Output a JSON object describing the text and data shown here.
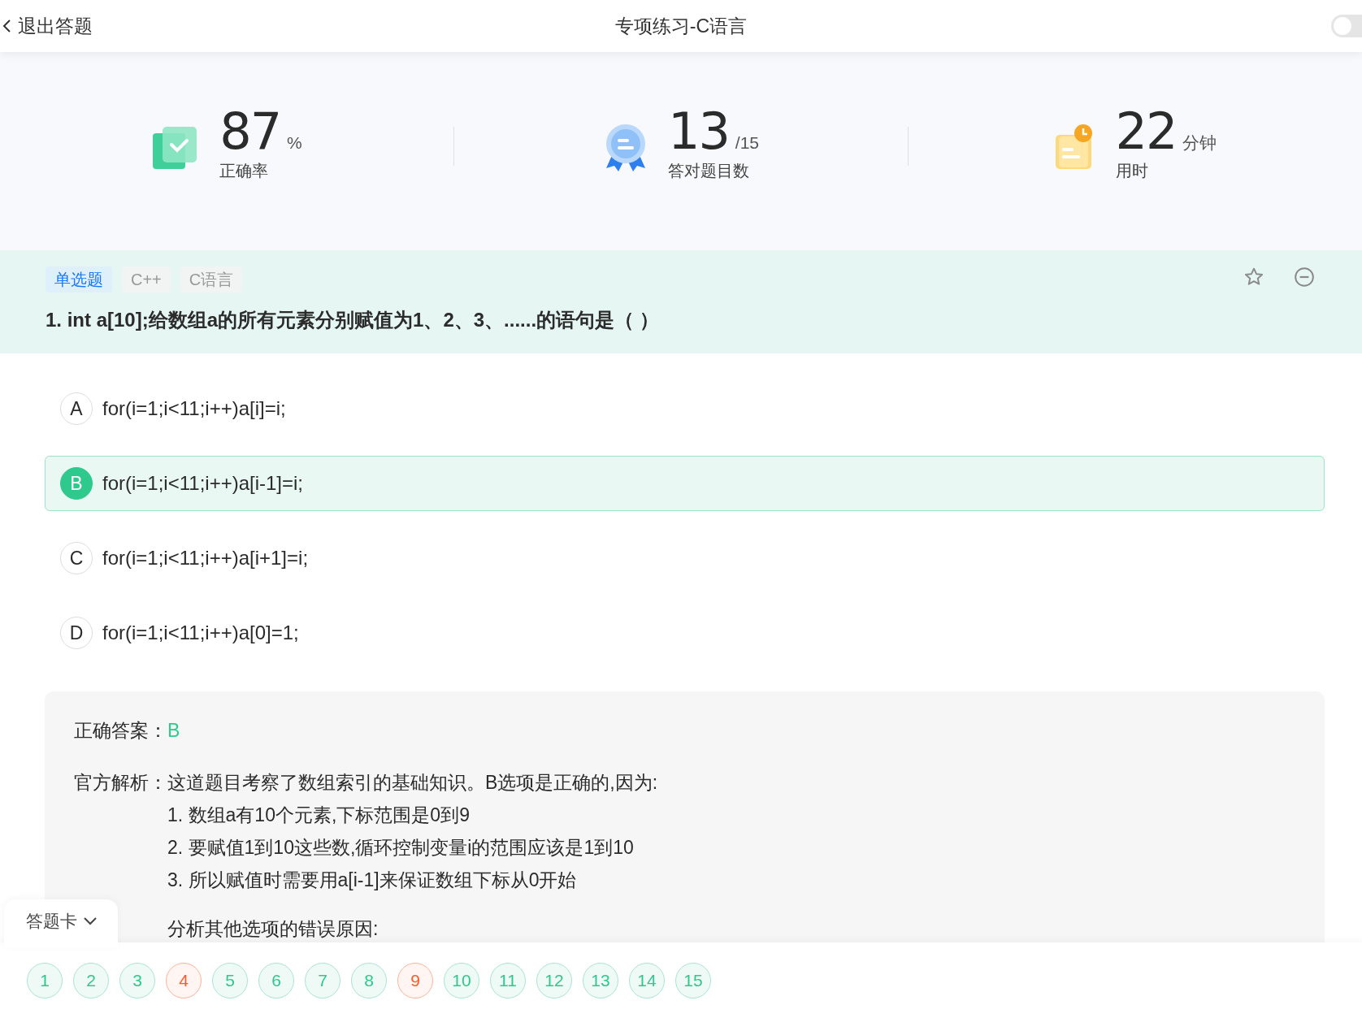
{
  "top_bar": {
    "back_label": "退出答题",
    "title": "专项练习-C语言",
    "toggle": {
      "on": false
    }
  },
  "stats": [
    {
      "kind": "accuracy",
      "value": "87",
      "unit": "%",
      "label": "正确率"
    },
    {
      "kind": "correct",
      "value": "13",
      "unit": "/15",
      "label": "答对题目数"
    },
    {
      "kind": "time",
      "value": "22",
      "unit": "分钟",
      "label": "用时"
    }
  ],
  "question": {
    "tags": [
      {
        "label": "单选题",
        "kind": "type"
      },
      {
        "label": "C++",
        "kind": "topic"
      },
      {
        "label": "C语言",
        "kind": "topic"
      }
    ],
    "text": "1. int a[10];给数组a的所有元素分别赋值为1、2、3、......的语句是（ ）"
  },
  "options": [
    {
      "letter": "A",
      "text": "for(i=1;i<11;i++)a[i]=i;",
      "selected": false
    },
    {
      "letter": "B",
      "text": "for(i=1;i<11;i++)a[i-1]=i;",
      "selected": true
    },
    {
      "letter": "C",
      "text": "for(i=1;i<11;i++)a[i+1]=i;",
      "selected": false
    },
    {
      "letter": "D",
      "text": "for(i=1;i<11;i++)a[0]=1;",
      "selected": false
    }
  ],
  "explanation": {
    "answer_label": "正确答案：",
    "answer": "B",
    "analysis_label": "官方解析：",
    "lines": [
      "这道题目考察了数组索引的基础知识。B选项是正确的,因为:",
      "1. 数组a有10个元素,下标范围是0到9",
      "2. 要赋值1到10这些数,循环控制变量i的范围应该是1到10",
      "3. 所以赋值时需要用a[i-1]来保证数组下标从0开始"
    ],
    "other_heading": "分析其他选项的错误原因:"
  },
  "answer_card": {
    "label": "答题卡",
    "items": [
      {
        "number": "1",
        "correct": true
      },
      {
        "number": "2",
        "correct": true
      },
      {
        "number": "3",
        "correct": true
      },
      {
        "number": "4",
        "correct": false
      },
      {
        "number": "5",
        "correct": true
      },
      {
        "number": "6",
        "correct": true
      },
      {
        "number": "7",
        "correct": true
      },
      {
        "number": "8",
        "correct": true
      },
      {
        "number": "9",
        "correct": false
      },
      {
        "number": "10",
        "correct": true
      },
      {
        "number": "11",
        "correct": true
      },
      {
        "number": "12",
        "correct": true
      },
      {
        "number": "13",
        "correct": true
      },
      {
        "number": "14",
        "correct": true
      },
      {
        "number": "15",
        "correct": true
      }
    ]
  }
}
